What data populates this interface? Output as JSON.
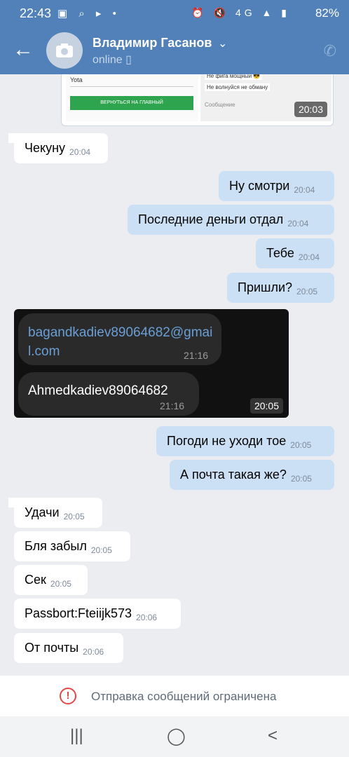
{
  "status_bar": {
    "time": "22:43",
    "left_icons": "▣ ⌕ ▸ •",
    "right_icons": "⏰ 🔇 4G ▲ ▮",
    "battery": "82%"
  },
  "header": {
    "contact_name": "Владимир Гасанов",
    "status": "online",
    "colors": {
      "bar": "#5181b8"
    }
  },
  "screenshot_attachment": {
    "yota_label": "Yota",
    "green_button": "ВЕРНУТЬСЯ НА ГЛАВНЫЙ",
    "msg1": "Не фига мощный 😎",
    "msg2": "Не волнуйся не обману",
    "input_placeholder": "Сообщение",
    "time": "20:03"
  },
  "messages": [
    {
      "dir": "in",
      "text": "Чекуну",
      "time": "20:04"
    },
    {
      "dir": "out",
      "text": "Ну смотри",
      "time": "20:04"
    },
    {
      "dir": "out",
      "text": "Последние деньги отдал",
      "time": "20:04"
    },
    {
      "dir": "out",
      "text": "Тебе",
      "time": "20:04"
    },
    {
      "dir": "out",
      "text": "Пришли?",
      "time": "20:05"
    },
    {
      "dir": "out",
      "text": "Погоди не уходи тое",
      "time": "20:05"
    },
    {
      "dir": "out",
      "text": "А почта такая же?",
      "time": "20:05"
    },
    {
      "dir": "in",
      "text": "Удачи",
      "time": "20:05"
    },
    {
      "dir": "in",
      "text": "Бля забыл",
      "time": "20:05"
    },
    {
      "dir": "in",
      "text": "Сек",
      "time": "20:05"
    },
    {
      "dir": "in",
      "text": "Passbort:Fteiijk573",
      "time": "20:06"
    },
    {
      "dir": "in",
      "text": "От почты",
      "time": "20:06"
    }
  ],
  "photo_attachment": {
    "bubble1_link": "bagandkadiev89064682@gmail.com",
    "bubble1_time": "21:16",
    "bubble2_text": "Ahmedkadiev89064682",
    "bubble2_time": "21:16",
    "time": "20:05"
  },
  "restriction": {
    "icon": "!",
    "text": "Отправка сообщений ограничена"
  },
  "navbar": {
    "recents": "|||",
    "home": "◯",
    "back": "<"
  },
  "icons": {
    "back": "←",
    "chevron": "⌄",
    "phone": "✆",
    "mobile": "▯"
  }
}
